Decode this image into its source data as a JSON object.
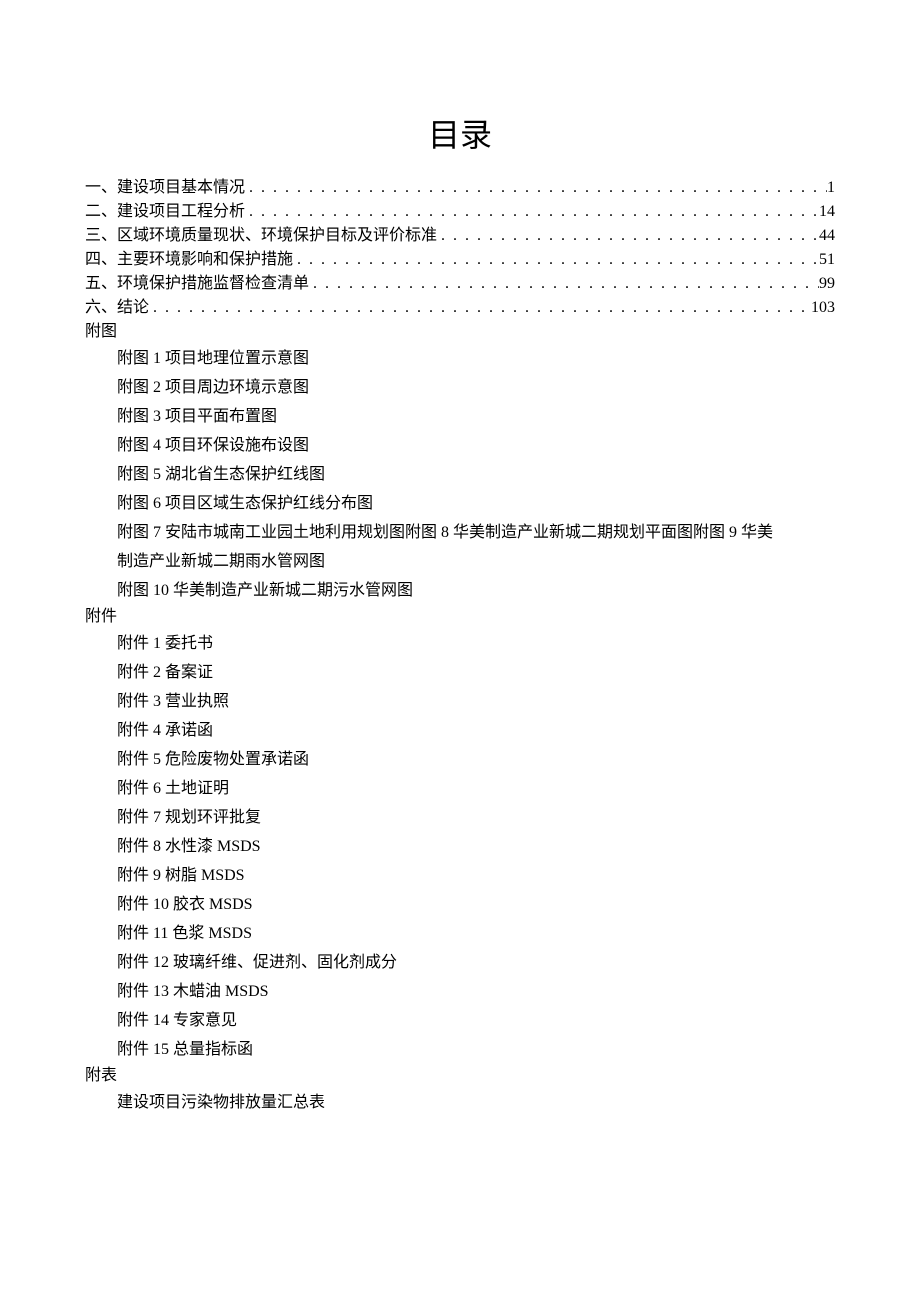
{
  "title": "目录",
  "toc": [
    {
      "label": "一、建设项目基本情况",
      "page": "1"
    },
    {
      "label": "二、建设项目工程分析",
      "page": "14"
    },
    {
      "label": "三、区域环境质量现状、环境保护目标及评价标准",
      "page": "44"
    },
    {
      "label": "四、主要环境影响和保护措施",
      "page": "51"
    },
    {
      "label": "五、环境保护措施监督检查清单",
      "page": "99"
    },
    {
      "label": "六、结论",
      "page": "103"
    }
  ],
  "dots": ". . . . . . . . . . . . . . . . . . . . . . . . . . . . . . . . . . . . . . . . . . . . . . . . . . . . . . . . . . . . . . . . . . . . . . . . . . . . . . . . . . . . . . . . . . . . . . . . . . . .",
  "sections": {
    "futu_header": "附图",
    "futu_items": [
      "附图 1 项目地理位置示意图",
      "附图 2 项目周边环境示意图",
      "附图 3 项目平面布置图",
      "附图 4 项目环保设施布设图",
      "附图 5 湖北省生态保护红线图",
      "附图 6 项目区域生态保护红线分布图"
    ],
    "futu_wrap_line1": "附图 7 安陆市城南工业园土地利用规划图附图 8 华美制造产业新城二期规划平面图附图 9 华美",
    "futu_wrap_line2": "制造产业新城二期雨水管网图",
    "futu_last": "附图 10 华美制造产业新城二期污水管网图",
    "fujian_header": "附件",
    "fujian_items": [
      "附件 1 委托书",
      "附件 2 备案证",
      "附件 3 营业执照",
      "附件 4 承诺函",
      "附件 5 危险废物处置承诺函",
      "附件 6 土地证明",
      "附件 7 规划环评批复",
      "附件 8 水性漆 MSDS",
      "附件 9 树脂 MSDS",
      "附件 10 胶衣 MSDS",
      "附件 11 色浆 MSDS",
      "附件 12 玻璃纤维、促进剂、固化剂成分",
      "附件 13 木蜡油 MSDS",
      "附件 14 专家意见",
      "附件 15 总量指标函"
    ],
    "fubiao_header": "附表",
    "fubiao_items": [
      "建设项目污染物排放量汇总表"
    ]
  }
}
